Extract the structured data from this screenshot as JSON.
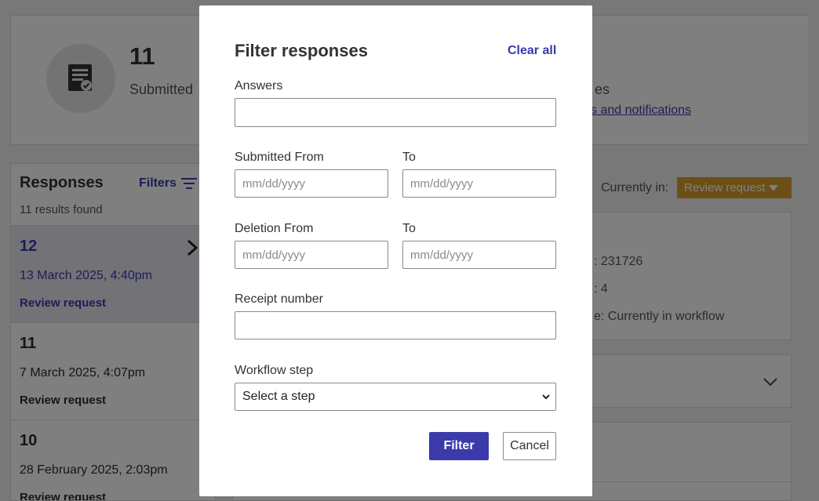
{
  "summary": {
    "count": "11",
    "label": "Submitted",
    "right_fragment": "es",
    "link_fragment": "s and notifications"
  },
  "responses": {
    "title": "Responses",
    "filters_label": "Filters",
    "results_found": "11 results found",
    "items": [
      {
        "number": "12",
        "date": "13 March 2025, 4:40pm",
        "status": "Review request"
      },
      {
        "number": "11",
        "date": "7 March 2025, 4:07pm",
        "status": "Review request"
      },
      {
        "number": "10",
        "date": "28 February 2025, 2:03pm",
        "status": "Review request"
      }
    ]
  },
  "detail": {
    "currently_in_label": "Currently in:",
    "workflow_badge": "Review request",
    "fragments": [
      ": 231726",
      ": 4",
      "e: Currently in workflow"
    ]
  },
  "modal": {
    "title": "Filter responses",
    "clear_all": "Clear all",
    "answers_label": "Answers",
    "answers_value": "",
    "submitted_from_label": "Submitted From",
    "submitted_to_label": "To",
    "deletion_from_label": "Deletion From",
    "deletion_to_label": "To",
    "date_placeholder": "mm/dd/yyyy",
    "receipt_label": "Receipt number",
    "receipt_value": "",
    "workflow_label": "Workflow step",
    "workflow_selected": "Select a step",
    "filter_button": "Filter",
    "cancel_button": "Cancel"
  },
  "colors": {
    "accent": "#3a3aaa",
    "badge": "#d99e2b",
    "overlay": "rgba(0,0,0,0.5)"
  },
  "icons": {
    "summary": "document-check-icon",
    "filters": "filter-lines-icon",
    "chevron_right": "chevron-right-icon",
    "chevron_down": "chevron-down-icon",
    "caret_down": "caret-down-icon"
  }
}
